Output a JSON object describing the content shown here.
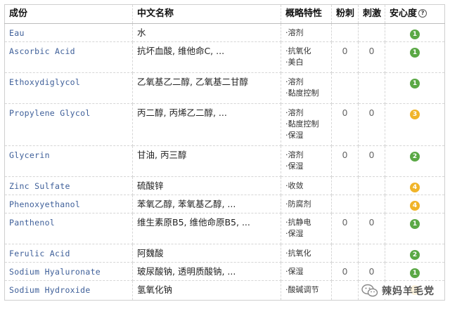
{
  "headers": {
    "ingredient": "成份",
    "chinese_name": "中文名称",
    "properties": "概略特性",
    "acne": "粉刺",
    "irritation": "刺激",
    "safety": "安心度",
    "safety_help_icon": "?"
  },
  "rows": [
    {
      "name": "Eau",
      "cn": "水",
      "props": [
        "·溶剂"
      ],
      "acne": "",
      "irr": "",
      "safety": "1",
      "safety_color": "#5aa845"
    },
    {
      "name": "Ascorbic Acid",
      "cn": "抗坏血酸, 维他命C, ...",
      "props": [
        "·抗氧化",
        "·美白"
      ],
      "acne": "0",
      "irr": "0",
      "safety": "1",
      "safety_color": "#5aa845"
    },
    {
      "name": "Ethoxydiglycol",
      "cn": "乙氧基乙二醇, 乙氧基二甘醇",
      "props": [
        "·溶剂",
        "·黏度控制"
      ],
      "acne": "",
      "irr": "",
      "safety": "1",
      "safety_color": "#5aa845"
    },
    {
      "name": "Propylene Glycol",
      "cn": "丙二醇, 丙烯乙二醇, ...",
      "props": [
        "·溶剂",
        "·黏度控制",
        "·保湿"
      ],
      "acne": "0",
      "irr": "0",
      "safety": "3",
      "safety_color": "#f0b429"
    },
    {
      "name": "Glycerin",
      "cn": "甘油, 丙三醇",
      "props": [
        "·溶剂",
        "·保湿"
      ],
      "acne": "0",
      "irr": "0",
      "safety": "2",
      "safety_color": "#5aa845"
    },
    {
      "name": "Zinc Sulfate",
      "cn": "硫酸锌",
      "props": [
        "·收敛"
      ],
      "acne": "",
      "irr": "",
      "safety": "4",
      "safety_color": "#f0b429"
    },
    {
      "name": "Phenoxyethanol",
      "cn": "苯氧乙醇, 苯氧基乙醇, ...",
      "props": [
        "·防腐剂"
      ],
      "acne": "",
      "irr": "",
      "safety": "4",
      "safety_color": "#f0b429"
    },
    {
      "name": "Panthenol",
      "cn": "维生素原B5, 维他命原B5, ...",
      "props": [
        "·抗静电",
        "·保湿"
      ],
      "acne": "0",
      "irr": "0",
      "safety": "1",
      "safety_color": "#5aa845"
    },
    {
      "name": "Ferulic Acid",
      "cn": "阿魏酸",
      "props": [
        "·抗氧化"
      ],
      "acne": "",
      "irr": "",
      "safety": "2",
      "safety_color": "#5aa845"
    },
    {
      "name": "Sodium Hyaluronate",
      "cn": "玻尿酸钠, 透明质酸钠, ...",
      "props": [
        "·保湿"
      ],
      "acne": "0",
      "irr": "0",
      "safety": "1",
      "safety_color": "#5aa845"
    },
    {
      "name": "Sodium Hydroxide",
      "cn": "氢氧化钠",
      "props": [
        "·酸碱调节"
      ],
      "acne": "",
      "irr": "",
      "safety": "",
      "safety_color": "#f0b429"
    }
  ],
  "watermark": {
    "icon": "wechat-icon",
    "text": "辣妈羊毛党"
  }
}
